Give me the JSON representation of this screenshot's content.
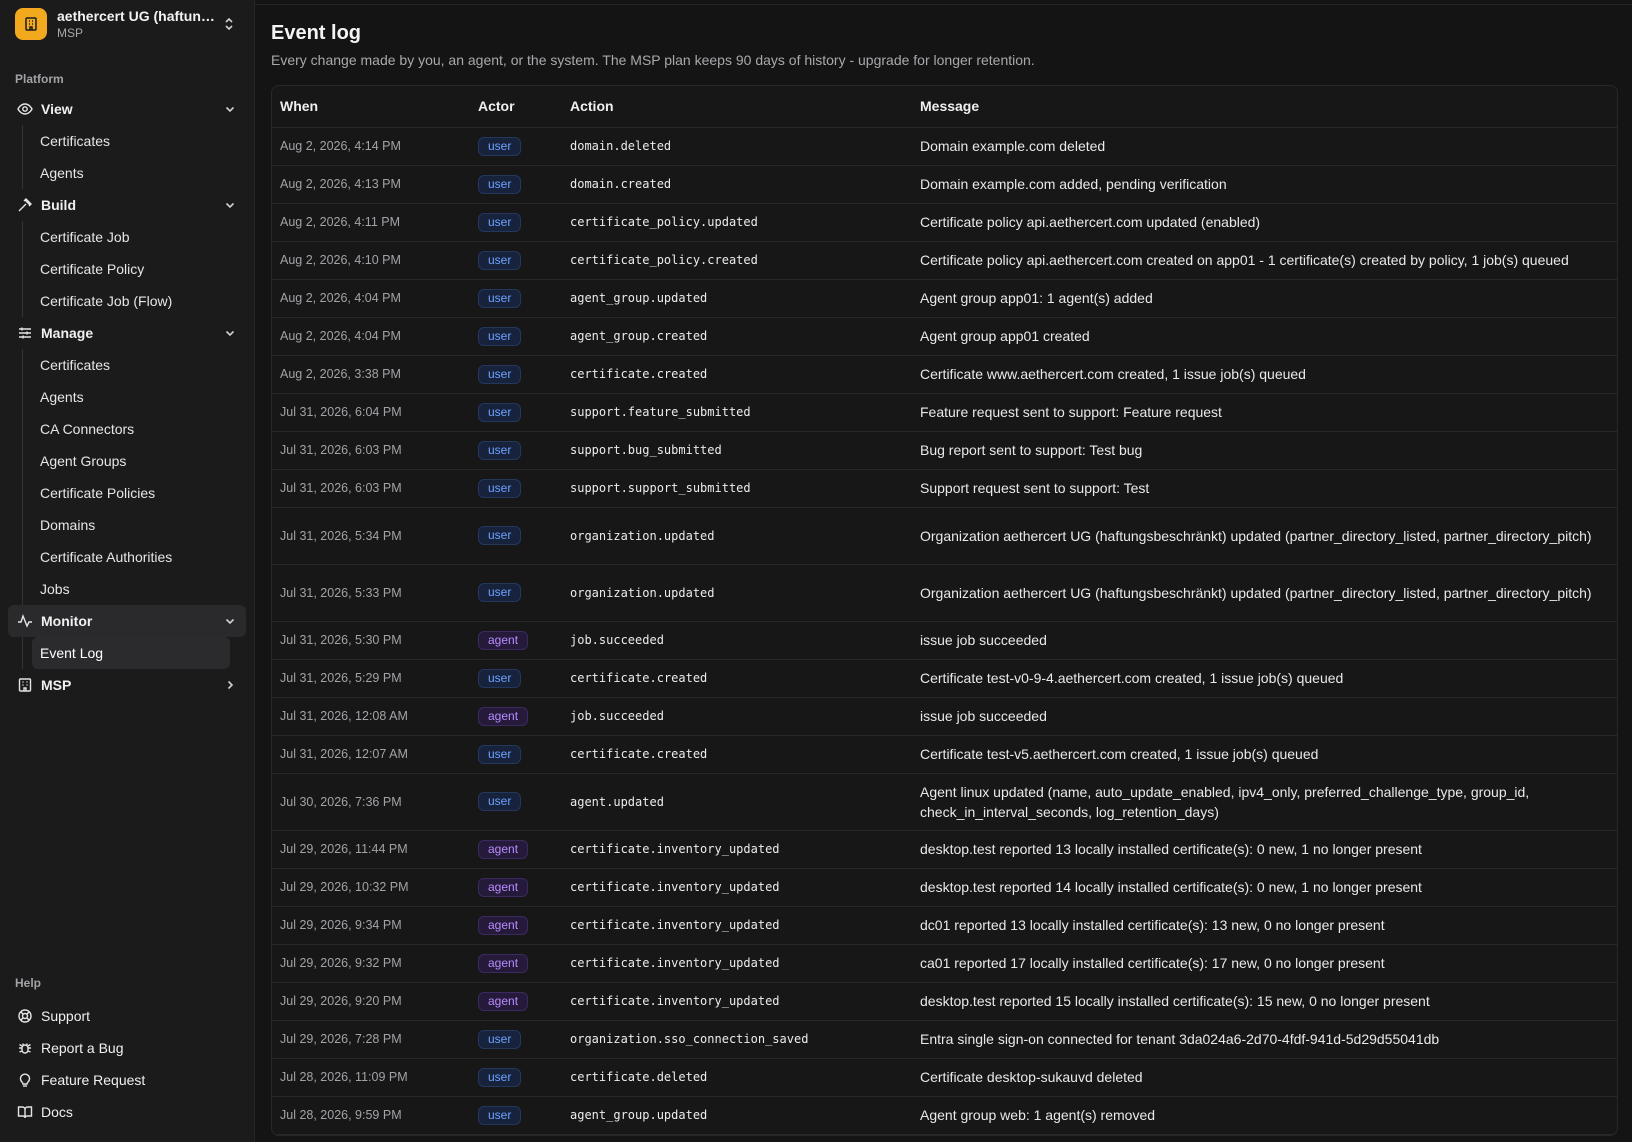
{
  "org": {
    "name": "aethercert UG (haftung...",
    "plan": "MSP"
  },
  "sidebar": {
    "platform_label": "Platform",
    "groups": [
      {
        "label": "View",
        "icon": "eye-icon",
        "items": [
          "Certificates",
          "Agents"
        ]
      },
      {
        "label": "Build",
        "icon": "hammer-icon",
        "items": [
          "Certificate Job",
          "Certificate Policy",
          "Certificate Job (Flow)"
        ]
      },
      {
        "label": "Manage",
        "icon": "sliders-icon",
        "items": [
          "Certificates",
          "Agents",
          "CA Connectors",
          "Agent Groups",
          "Certificate Policies",
          "Domains",
          "Certificate Authorities",
          "Jobs"
        ]
      },
      {
        "label": "Monitor",
        "icon": "activity-icon",
        "items": [
          "Event Log"
        ]
      },
      {
        "label": "MSP",
        "icon": "building-icon",
        "items": []
      }
    ],
    "help_label": "Help",
    "help_items": [
      {
        "label": "Support",
        "icon": "lifebuoy-icon"
      },
      {
        "label": "Report a Bug",
        "icon": "bug-icon"
      },
      {
        "label": "Feature Request",
        "icon": "lightbulb-icon"
      },
      {
        "label": "Docs",
        "icon": "book-icon"
      }
    ]
  },
  "page": {
    "title": "Event log",
    "subtitle": "Every change made by you, an agent, or the system. The MSP plan keeps 90 days of history - upgrade for longer retention."
  },
  "table": {
    "columns": [
      "When",
      "Actor",
      "Action",
      "Message"
    ],
    "rows": [
      {
        "when": "Aug 2, 2026, 4:14 PM",
        "actor": "user",
        "action": "domain.deleted",
        "message": "Domain example.com deleted"
      },
      {
        "when": "Aug 2, 2026, 4:13 PM",
        "actor": "user",
        "action": "domain.created",
        "message": "Domain example.com added, pending verification"
      },
      {
        "when": "Aug 2, 2026, 4:11 PM",
        "actor": "user",
        "action": "certificate_policy.updated",
        "message": "Certificate policy api.aethercert.com updated (enabled)"
      },
      {
        "when": "Aug 2, 2026, 4:10 PM",
        "actor": "user",
        "action": "certificate_policy.created",
        "message": "Certificate policy api.aethercert.com created on app01 - 1 certificate(s) created by policy, 1 job(s) queued"
      },
      {
        "when": "Aug 2, 2026, 4:04 PM",
        "actor": "user",
        "action": "agent_group.updated",
        "message": "Agent group app01: 1 agent(s) added"
      },
      {
        "when": "Aug 2, 2026, 4:04 PM",
        "actor": "user",
        "action": "agent_group.created",
        "message": "Agent group app01 created"
      },
      {
        "when": "Aug 2, 2026, 3:38 PM",
        "actor": "user",
        "action": "certificate.created",
        "message": "Certificate www.aethercert.com created, 1 issue job(s) queued"
      },
      {
        "when": "Jul 31, 2026, 6:04 PM",
        "actor": "user",
        "action": "support.feature_submitted",
        "message": "Feature request sent to support: Feature request"
      },
      {
        "when": "Jul 31, 2026, 6:03 PM",
        "actor": "user",
        "action": "support.bug_submitted",
        "message": "Bug report sent to support: Test bug"
      },
      {
        "when": "Jul 31, 2026, 6:03 PM",
        "actor": "user",
        "action": "support.support_submitted",
        "message": "Support request sent to support: Test"
      },
      {
        "when": "Jul 31, 2026, 5:34 PM",
        "actor": "user",
        "action": "organization.updated",
        "message": "Organization aethercert UG (haftungsbeschränkt) updated (partner_directory_listed, partner_directory_pitch)",
        "tall": true
      },
      {
        "when": "Jul 31, 2026, 5:33 PM",
        "actor": "user",
        "action": "organization.updated",
        "message": "Organization aethercert UG (haftungsbeschränkt) updated (partner_directory_listed, partner_directory_pitch)",
        "tall": true
      },
      {
        "when": "Jul 31, 2026, 5:30 PM",
        "actor": "agent",
        "action": "job.succeeded",
        "message": "issue job succeeded"
      },
      {
        "when": "Jul 31, 2026, 5:29 PM",
        "actor": "user",
        "action": "certificate.created",
        "message": "Certificate test-v0-9-4.aethercert.com created, 1 issue job(s) queued"
      },
      {
        "when": "Jul 31, 2026, 12:08 AM",
        "actor": "agent",
        "action": "job.succeeded",
        "message": "issue job succeeded"
      },
      {
        "when": "Jul 31, 2026, 12:07 AM",
        "actor": "user",
        "action": "certificate.created",
        "message": "Certificate test-v5.aethercert.com created, 1 issue job(s) queued"
      },
      {
        "when": "Jul 30, 2026, 7:36 PM",
        "actor": "user",
        "action": "agent.updated",
        "message": "Agent linux updated (name, auto_update_enabled, ipv4_only, preferred_challenge_type, group_id, check_in_interval_seconds, log_retention_days)",
        "tall": true
      },
      {
        "when": "Jul 29, 2026, 11:44 PM",
        "actor": "agent",
        "action": "certificate.inventory_updated",
        "message": "desktop.test reported 13 locally installed certificate(s): 0 new, 1 no longer present"
      },
      {
        "when": "Jul 29, 2026, 10:32 PM",
        "actor": "agent",
        "action": "certificate.inventory_updated",
        "message": "desktop.test reported 14 locally installed certificate(s): 0 new, 1 no longer present"
      },
      {
        "when": "Jul 29, 2026, 9:34 PM",
        "actor": "agent",
        "action": "certificate.inventory_updated",
        "message": "dc01 reported 13 locally installed certificate(s): 13 new, 0 no longer present"
      },
      {
        "when": "Jul 29, 2026, 9:32 PM",
        "actor": "agent",
        "action": "certificate.inventory_updated",
        "message": "ca01 reported 17 locally installed certificate(s): 17 new, 0 no longer present"
      },
      {
        "when": "Jul 29, 2026, 9:20 PM",
        "actor": "agent",
        "action": "certificate.inventory_updated",
        "message": "desktop.test reported 15 locally installed certificate(s): 15 new, 0 no longer present"
      },
      {
        "when": "Jul 29, 2026, 7:28 PM",
        "actor": "user",
        "action": "organization.sso_connection_saved",
        "message": "Entra single sign-on connected for tenant 3da024a6-2d70-4fdf-941d-5d29d55041db"
      },
      {
        "when": "Jul 28, 2026, 11:09 PM",
        "actor": "user",
        "action": "certificate.deleted",
        "message": "Certificate desktop-sukauvd deleted"
      },
      {
        "when": "Jul 28, 2026, 9:59 PM",
        "actor": "user",
        "action": "agent_group.updated",
        "message": "Agent group web: 1 agent(s) removed"
      }
    ]
  },
  "colors": {
    "accent_org": "#f2a91d",
    "badge_user": "#6ea1ff",
    "badge_agent": "#b78cff"
  }
}
